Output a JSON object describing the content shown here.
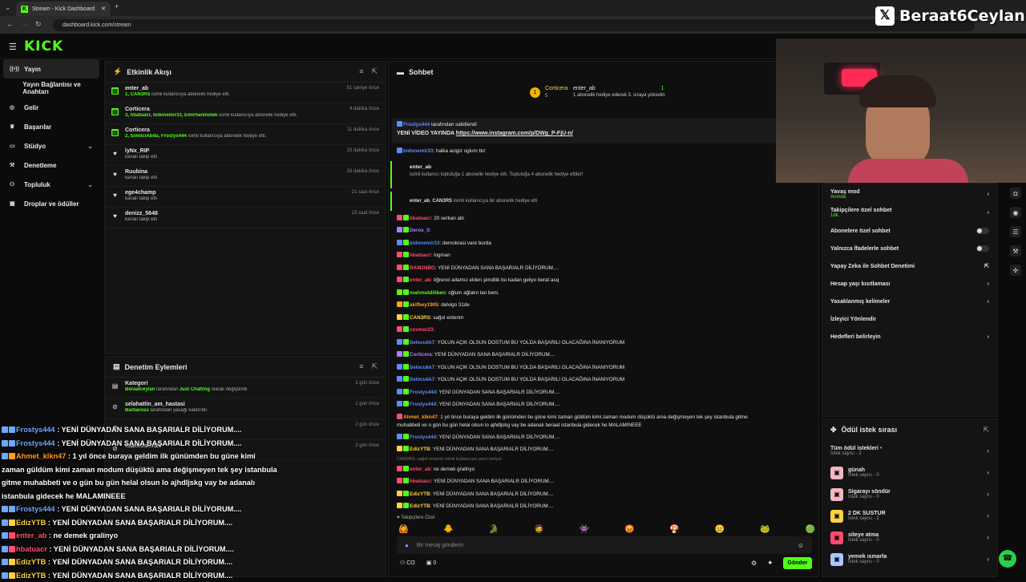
{
  "browser": {
    "tab_title": "Stream - Kick Dashboard",
    "url": "dashboard.kick.com/stream",
    "new_tab": "+",
    "close": "✕"
  },
  "brand": {
    "logo": "KICK",
    "accent": "#53fc18"
  },
  "sidebar": {
    "items": [
      {
        "label": "Yayın",
        "icon": "broadcast-icon",
        "active": true
      },
      {
        "label": "Yayın Bağlantısı ve Anahtarı",
        "icon": "key-icon"
      },
      {
        "label": "Gelir",
        "icon": "money-icon"
      },
      {
        "label": "Başarılar",
        "icon": "trophy-icon"
      },
      {
        "label": "Stüdyo",
        "icon": "studio-icon",
        "chevron": true
      },
      {
        "label": "Denetleme",
        "icon": "hammer-icon"
      },
      {
        "label": "Topluluk",
        "icon": "community-icon",
        "chevron": true
      },
      {
        "label": "Droplar ve ödüller",
        "icon": "gift-icon"
      }
    ]
  },
  "activity": {
    "title": "Etkinlik Akışı",
    "events": [
      {
        "name": "enter_ab",
        "icon": "gift-icon",
        "desc_hl": "1, CAN3RS",
        "desc": " isimli kullanıcıya abonelik hediye etti.",
        "time": "51 saniye önce"
      },
      {
        "name": "Corticera",
        "icon": "gift-icon",
        "desc_hl": "3, hbatuacr, bidonemir33, Emirhanmetek",
        "desc": " isimli kullanıcıya abonelik hediye etti.",
        "time": "4 dakika önce"
      },
      {
        "name": "Corticera",
        "icon": "gift-icon",
        "desc_hl": "2, SimitciAbdu, Frostys444",
        "desc": " isimli kullanıcıya abonelik hediye etti.",
        "time": "11 dakika önce"
      },
      {
        "name": "lyNx_RIP",
        "icon": "heart-icon",
        "desc_hl": "",
        "desc": "kanalı takip etti",
        "time": "20 dakika önce"
      },
      {
        "name": "Ruubina",
        "icon": "heart-icon",
        "desc_hl": "",
        "desc": "kanalı takip etti",
        "time": "33 dakika önce"
      },
      {
        "name": "ege4champ",
        "icon": "heart-icon",
        "desc_hl": "",
        "desc": "kanalı takip etti",
        "time": "21 saat önce"
      },
      {
        "name": "denizz_5648",
        "icon": "heart-icon",
        "desc_hl": "",
        "desc": "kanalı takip etti",
        "time": "23 saat önce"
      }
    ]
  },
  "moderation": {
    "title": "Denetim Eylemleri",
    "items": [
      {
        "name": "Kategori",
        "user": "Beraatceylan",
        "desc": " tarafından ",
        "hl": "Just Chatting",
        "desc2": " olarak değiştirildi",
        "time": "1 gün önce"
      },
      {
        "name": "selahattin_am_hastasi",
        "user": "Barbaross",
        "desc": " tarafından yasağı kaldırıldı",
        "hl": "",
        "desc2": "",
        "time": "1 gün önce"
      },
      {
        "name": "",
        "user": "",
        "desc": "",
        "hl": "",
        "desc2": "",
        "time": "2 gün önce"
      },
      {
        "name": "kaankeskin24",
        "user": "",
        "desc": "",
        "hl": "",
        "desc2": "",
        "time": "2 gün önce"
      }
    ]
  },
  "chat": {
    "title": "Sohbet",
    "top_gifter": {
      "name": "Corticera",
      "count": "5",
      "rank": "1"
    },
    "top_event": {
      "name": "enter_ab",
      "count": "1",
      "sub": "1 abonelik hediye ederek 3. sıraya yükselin"
    },
    "pinned": {
      "by": "Frostys444",
      "label": " tarafından sabitlendi",
      "text": "YENİ VİDEO YAYINDA ",
      "link": "https://www.instagram.com/p/DWg_P-FjU-n/"
    },
    "pre": {
      "user": "bidonemir33",
      "text": ": halka acigiz oglum biz"
    },
    "gift_card": {
      "user": "enter_ab",
      "text": "isimli kullanıcı topluluğa 1 abonelik hediye etti. Topluluğa 4 abonelik hediye ettiler!"
    },
    "gift_line": {
      "user": "enter_ab",
      "target": "CAN3RS",
      "text": " isimli kullanıcıya bir abonelik hediye etti"
    },
    "messages": [
      {
        "user": "hbatuacr",
        "color": "#ff4d6d",
        "text": ": 20 serkan abi"
      },
      {
        "user": "Derox_0",
        "color": "#b07cff",
        "text": ":"
      },
      {
        "user": "bidonemir33",
        "color": "#5b8cff",
        "text": ": demokrasi vare burda"
      },
      {
        "user": "hbatuacr",
        "color": "#ff4d6d",
        "text": ": logman"
      },
      {
        "user": "RAM2NBO",
        "color": "#ff4d6d",
        "text": ": YENİ DÜNYADAN SANA BAŞARIALR DİLİYORUM...."
      },
      {
        "user": "enter_ab",
        "color": "#ff4d6d",
        "text": ": öğrenci adamız elden şimdilik bu kadan geliyo berat asq"
      },
      {
        "user": "mahmutdiliben",
        "color": "#53fc18",
        "text": ": oğlum ağlatın lan beni."
      },
      {
        "user": "akifbey1905",
        "color": "#ff9f1c",
        "text": ": delvigo 31de"
      },
      {
        "user": "CAN3RS",
        "color": "#ffd23f",
        "text": ": sağol entenm"
      },
      {
        "user": "cosmer23",
        "color": "#ff4d6d",
        "text": ":"
      },
      {
        "user": "Selocukk7",
        "color": "#5b8cff",
        "text": ": YOLUN AÇIK OLSUN DOSTUM BU YOLDA BAŞARILI OLACAĞINA İNANIYORUM"
      },
      {
        "user": "Corticera",
        "color": "#b07cff",
        "text": ": YENİ DÜNYADAN SANA BAŞARIALR DİLİYORUM...."
      },
      {
        "user": "Selocukk7",
        "color": "#5b8cff",
        "text": ": YOLUN AÇIK OLSUN DOSTUM BU YOLDA BAŞARILI OLACAĞINA İNANIYORUM"
      },
      {
        "user": "Selocukk7",
        "color": "#5b8cff",
        "text": ": YOLUN AÇIK OLSUN DOSTUM BU YOLDA BAŞARILI OLACAĞINA İNANIYORUM"
      },
      {
        "user": "Frostys444",
        "color": "#5b8cff",
        "text": ": YENİ DÜNYADAN SANA BAŞARIALR DİLİYORUM...."
      },
      {
        "user": "Frostys444",
        "color": "#5b8cff",
        "text": ": YENİ DÜNYADAN SANA BAŞARIALR DİLİYORUM...."
      }
    ],
    "long_msg": {
      "user": "Ahmet_klkn47",
      "color": "#ff9f1c",
      "line1": ": 1 yıl önce buraya geldim ilk günümden bu güne kimi zaman güldüm kimi zaman modum düşüktü ama değişmeyen tek şey istanbula gitme",
      "line2": "muhabbeti ve o gün bu gün helal olsun lo ajhdljskg vay be adanalı beraat istanbula gidecek he MALAMINEEE"
    },
    "messages2": [
      {
        "user": "Frostys444",
        "color": "#5b8cff",
        "text": ": YENİ DÜNYADAN SANA BAŞARIALR DİLİYORUM...."
      },
      {
        "user": "EdizYTB",
        "color": "#ffd23f",
        "text": ": YENİ DÜNYADAN SANA BAŞARIALR DİLİYORUM...."
      }
    ],
    "deleted": "CAN3RS: sağol entenm isimli kullanıcıya yanıt veriyor",
    "messages3": [
      {
        "user": "enter_ab",
        "color": "#ff4d6d",
        "text": ": ne demek gralinyo"
      },
      {
        "user": "hbatuacr",
        "color": "#ff4d6d",
        "text": ": YENİ DÜNYADAN SANA BAŞARIALR DİLİYORUM...."
      },
      {
        "user": "EdizYTB",
        "color": "#ffd23f",
        "text": ": YENİ DÜNYADAN SANA BAŞARIALR DİLİYORUM...."
      },
      {
        "user": "EdizYTB",
        "color": "#ffd23f",
        "text": ": YENİ DÜNYADAN SANA BAŞARIALR DİLİYORUM...."
      }
    ],
    "followers_only": "Takipçilere Özel",
    "input_placeholder": "Bir mesaj gönderin",
    "send": "Gönder",
    "viewer_count": "CO",
    "points": "0"
  },
  "settings": {
    "items": [
      {
        "label": "Yavaş mod",
        "sub": "Anında",
        "type": "chevron"
      },
      {
        "label": "Takipçilere özel sohbet",
        "sub": "1dk.",
        "type": "chevron"
      },
      {
        "label": "Abonelere özel sohbet",
        "sub": "",
        "type": "toggle"
      },
      {
        "label": "Yalnızca İfadelerle sohbet",
        "sub": "",
        "type": "toggle"
      },
      {
        "label": "Yapay Zeka ile Sohbet Denetimi",
        "sub": "",
        "type": "external"
      },
      {
        "label": "Hesap yaşı kısıtlaması",
        "sub": "",
        "type": "chevron"
      },
      {
        "label": "Yasaklanmış kelimeler",
        "sub": "",
        "type": "chevron"
      },
      {
        "label": "İzleyici Yönlendir",
        "sub": "",
        "type": "none"
      },
      {
        "label": "Hedefleri belirleyin",
        "sub": "",
        "type": "chevron"
      }
    ]
  },
  "rewards": {
    "title": "Ödül istek sırası",
    "all": {
      "label": "Tüm ödül istekleri",
      "sub": "İstek sayısı - 2"
    },
    "items": [
      {
        "label": "günah",
        "sub": "İstek sayısı - 0",
        "color": "#f4b6c2"
      },
      {
        "label": "Sigarayı söndür",
        "sub": "İstek sayısı - 0",
        "color": "#f4b6c2"
      },
      {
        "label": "2 DK SUSTUR",
        "sub": "İstek sayısı - 2",
        "color": "#ffd23f"
      },
      {
        "label": "siteye atma",
        "sub": "İstek sayısı - 0",
        "color": "#ff4d6d"
      },
      {
        "label": "yemek ısmarla",
        "sub": "İstek sayısı - 0",
        "color": "#a7c7ff"
      }
    ]
  },
  "overlay": {
    "handle": "Beraat6Ceylan",
    "lines": [
      {
        "user": "Frostys444",
        "color": "#6fa8ff",
        "text": " : YENİ DÜNYADAN SANA BAŞARIALR DİLİYORUM...."
      },
      {
        "user": "Frostys444",
        "color": "#6fa8ff",
        "text": " : YENİ DÜNYADAN SANA BAŞARIALR DİLİYORUM...."
      },
      {
        "user": "Ahmet_klkn47",
        "color": "#ff9f1c",
        "text": " : 1 yıl önce buraya geldim ilk günümden bu güne kimi"
      },
      {
        "user": "",
        "color": "#fff",
        "text": "zaman güldüm kimi zaman modum düşüktü ama değişmeyen tek şey istanbula"
      },
      {
        "user": "",
        "color": "#fff",
        "text": "gitme muhabbeti ve o gün bu gün helal olsun lo ajhdljskg vay be adanalı"
      },
      {
        "user": "",
        "color": "#fff",
        "text": "istanbula gidecek he MALAMINEEE"
      },
      {
        "user": "Frostys444",
        "color": "#6fa8ff",
        "text": " : YENİ DÜNYADAN SANA BAŞARIALR DİLİYORUM...."
      },
      {
        "user": "EdizYTB",
        "color": "#ffd23f",
        "text": " : YENİ DÜNYADAN SANA BAŞARIALR DİLİYORUM...."
      },
      {
        "user": "enter_ab",
        "color": "#ff4d6d",
        "text": " : ne demek gralinyo"
      },
      {
        "user": "hbatuacr",
        "color": "#ff4d6d",
        "text": " : YENİ DÜNYADAN SANA BAŞARIALR DİLİYORUM...."
      },
      {
        "user": "EdizYTB",
        "color": "#ffd23f",
        "text": " : YENİ DÜNYADAN SANA BAŞARIALR DİLİYORUM...."
      },
      {
        "user": "EdizYTB",
        "color": "#ffd23f",
        "text": " : YENİ DÜNYADAN SANA BAŞARIALR DİLİYORUM...."
      }
    ]
  }
}
